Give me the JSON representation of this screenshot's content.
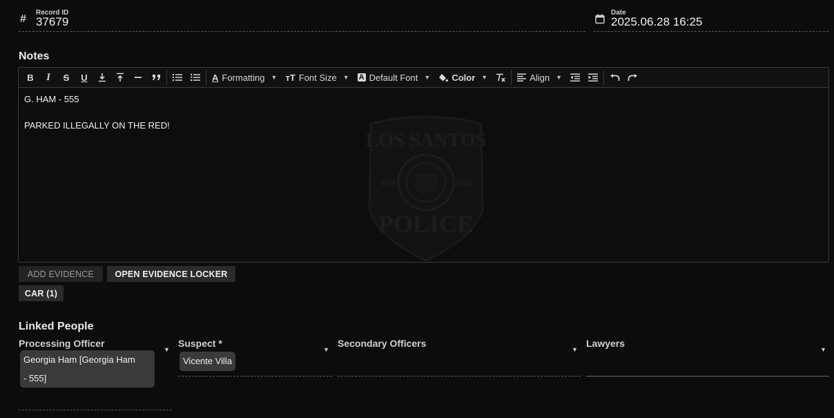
{
  "record": {
    "label": "Record ID",
    "value": "37679"
  },
  "date": {
    "label": "Date",
    "value": "2025.06.28 16:25"
  },
  "notes": {
    "title": "Notes",
    "toolbar": {
      "formatting": "Formatting",
      "font_size": "Font Size",
      "font_family": "Default Font",
      "color": "Color",
      "align": "Align"
    },
    "lines": [
      "G. HAM - 555",
      "PARKED ILLEGALLY ON THE RED!"
    ],
    "watermark": {
      "top": "LOS SANTOS",
      "bottom": "POLICE",
      "est": "EST",
      "year": "1912"
    }
  },
  "evidence": {
    "add_label": "ADD EVIDENCE",
    "open_label": "OPEN EVIDENCE LOCKER",
    "tag_label": "CAR (1)"
  },
  "linked_people": {
    "title": "Linked People",
    "processing_officer": {
      "label": "Processing Officer",
      "chip_line1": "Georgia Ham [Georgia Ham",
      "chip_line2": "- 555]"
    },
    "suspect": {
      "label": "Suspect *",
      "chip": "Vicente Villa"
    },
    "secondary_officers": {
      "label": "Secondary Officers"
    },
    "lawyers": {
      "label": "Lawyers"
    }
  },
  "colors": {
    "background": "#0c0c0c",
    "chip": "#3a3a3a",
    "button": "#2b2b2b"
  }
}
